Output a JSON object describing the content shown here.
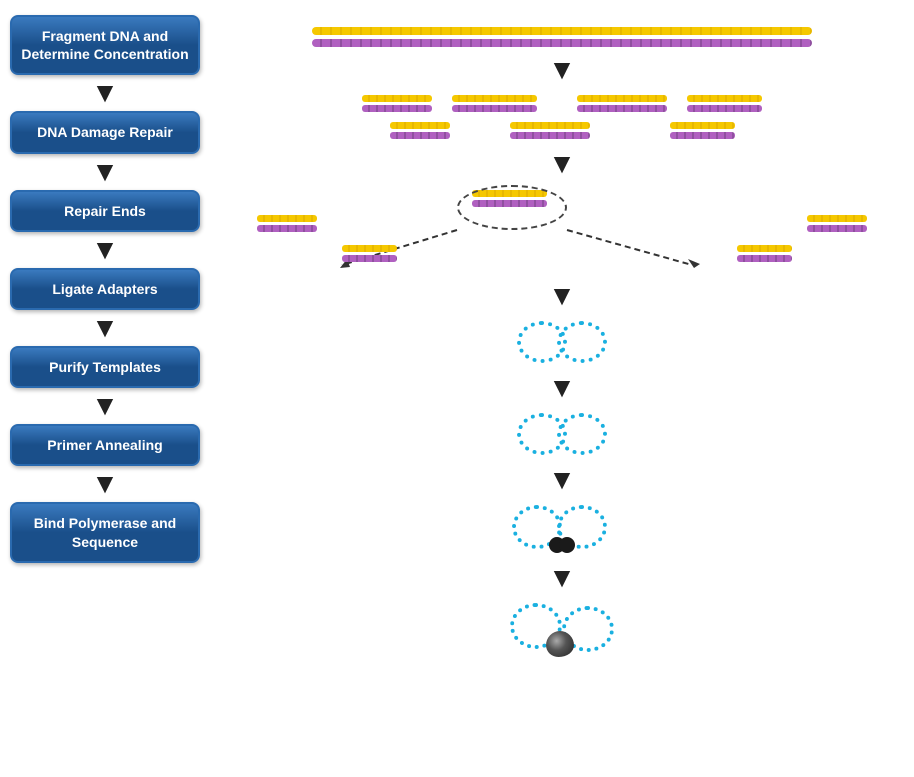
{
  "steps": [
    {
      "id": "step1",
      "label": "Fragment DNA and\nDetermine Concentration"
    },
    {
      "id": "step2",
      "label": "DNA Damage Repair"
    },
    {
      "id": "step3",
      "label": "Repair Ends"
    },
    {
      "id": "step4",
      "label": "Ligate Adapters"
    },
    {
      "id": "step5",
      "label": "Purify Templates"
    },
    {
      "id": "step6",
      "label": "Primer Annealing"
    },
    {
      "id": "step7",
      "label": "Bind Polymerase\nand Sequence"
    }
  ],
  "arrows": [
    "▼",
    "▼",
    "▼",
    "▼",
    "▼",
    "▼"
  ],
  "colors": {
    "strandTop": "#f5c800",
    "strandBottom": "#b060c0",
    "adapter": "#1ab0e0",
    "stepBg": "#1a4f8a",
    "arrowColor": "#222222"
  }
}
